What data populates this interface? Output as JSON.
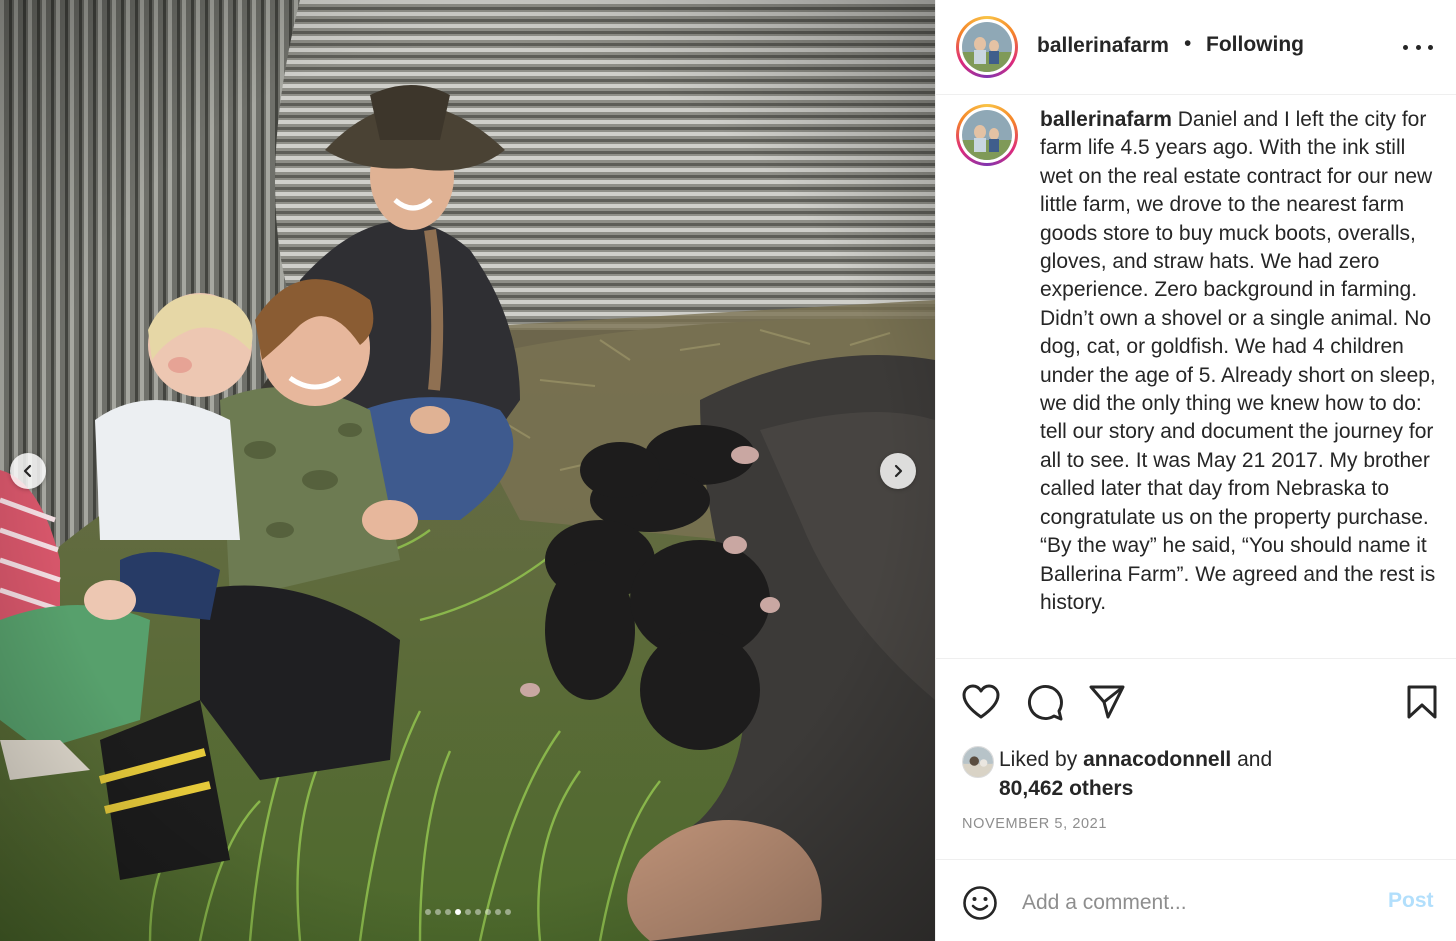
{
  "post": {
    "username": "ballerinafarm",
    "separator": "•",
    "follow_status": "Following",
    "caption_user": "ballerinafarm",
    "caption_text": " Daniel and I left the city for farm life 4.5 years ago. With the ink still wet on the real estate contract for our new little farm, we drove to the nearest farm goods store to buy muck boots, overalls, gloves, and straw hats. We had zero experience. Zero background in farming. Didn’t own a shovel or a single animal. No dog, cat, or goldfish. We had 4 children under the age of 5. Already short on sleep, we did the only thing we knew how to do: tell our story and document the journey for all to see. It was May 21 2017. My brother called later that day from Nebraska to congratulate us on the property purchase. “By the way” he said, “You should name it Ballerina Farm”. We agreed and the rest is history."
  },
  "likes": {
    "prefix": "Liked by ",
    "user": "annacodonnell",
    "suffix": " and",
    "count": "80,462 others"
  },
  "date": "NOVEMBER 5, 2021",
  "comment": {
    "placeholder": "Add a comment...",
    "post_label": "Post"
  },
  "carousel": {
    "slide_count": 9,
    "active_index": 3
  },
  "icons": {
    "like": "heart-icon",
    "comment": "comment-bubble-icon",
    "share": "paper-plane-icon",
    "save": "bookmark-icon",
    "more": "more-horizontal-icon",
    "emoji": "emoji-smile-icon",
    "prev": "chevron-left-icon",
    "next": "chevron-right-icon"
  },
  "colors": {
    "text": "#262626",
    "muted": "#8e8e8e",
    "post_disabled": "#b2dffc",
    "divider": "#efefef"
  }
}
